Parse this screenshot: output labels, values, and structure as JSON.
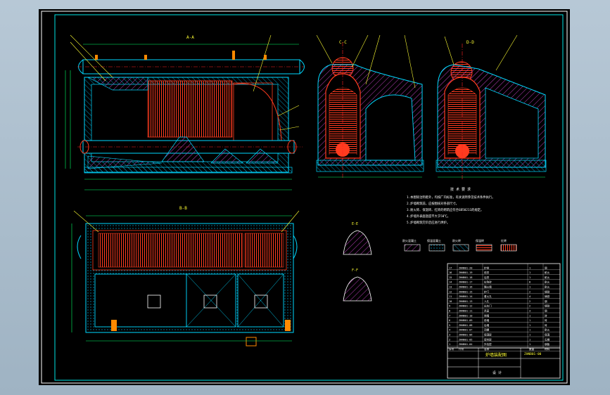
{
  "colors": {
    "background": "#000000",
    "frame": "#ffffff",
    "border_cyan": "#00e5e5",
    "tubes": "#ff3b1f",
    "hatch": "#ff40ff",
    "dims": "#00ff66",
    "leaders": "#ffff33",
    "centerlines": "#ff2020",
    "steel": "#00d8ff",
    "viewport": "#a9bccb"
  },
  "views": {
    "section_a": "A-A",
    "section_b": "B-B",
    "section_c": "C-C",
    "section_d": "D-D",
    "detail_1": "E-E",
    "detail_2": "F-F"
  },
  "notes": {
    "heading": "技 术 要 求",
    "lines": [
      "1.本图除注明者外，均按厂内标准，有关说明参见技术条件执行。",
      "2.炉墙砌筑前，应按图核对各部尺寸。",
      "3.耐火砖、保温砖、红砖的砌筑应符合GB50211的规定。",
      "4.炉墙外表面温度不大于50℃。",
      "5.炉墙砌筑完毕后应进行烘炉。"
    ]
  },
  "legend": [
    "耐火混凝土",
    "保温混凝土",
    "耐火砖",
    "保温砖",
    "红砖"
  ],
  "parts_table": {
    "rows": [
      [
        "17",
        "ZHNB01-20",
        "炉排",
        "1",
        "钢"
      ],
      [
        "16",
        "ZHNB01-19",
        "前拱",
        "1",
        "耐火"
      ],
      [
        "15",
        "ZHNB01-18",
        "后拱",
        "1",
        "耐火"
      ],
      [
        "14",
        "ZHNB01-17",
        "拉钩砖",
        "8",
        "耐火"
      ],
      [
        "13",
        "ZHNB01-16",
        "隔火墙",
        "1",
        "耐火"
      ],
      [
        "12",
        "ZHNB01-15",
        "炉门",
        "2",
        "铸铁"
      ],
      [
        "11",
        "ZHNB01-14",
        "看火孔",
        "4",
        "铸铁"
      ],
      [
        "10",
        "ZHNB01-13",
        "人孔",
        "2",
        "钢"
      ],
      [
        "9",
        "ZHNB01-12",
        "出灰门",
        "2",
        "铸铁"
      ],
      [
        "8",
        "ZHNB01-11",
        "风室",
        "3",
        "钢"
      ],
      [
        "7",
        "ZHNB01-10",
        "侧墙",
        "1",
        "砖"
      ],
      [
        "6",
        "ZHNB01-09",
        "前墙",
        "1",
        "砖"
      ],
      [
        "5",
        "ZHNB01-08",
        "后墙",
        "1",
        "砖"
      ],
      [
        "4",
        "ZHNB01-07",
        "顶棚",
        "1",
        "耐火"
      ],
      [
        "3",
        "ZHNB01-06",
        "保温层",
        "1",
        "保温"
      ],
      [
        "2",
        "ZHNB01-05",
        "密封层",
        "1",
        "石棉"
      ],
      [
        "1",
        "ZHNB01-04",
        "外包层",
        "1",
        "钢板"
      ]
    ],
    "header": [
      "序号",
      "代号",
      "名称",
      "数量",
      "材料"
    ]
  },
  "title_block": {
    "drawing_title": "炉墙装配图",
    "drawing_no": "ZHNB01-00",
    "designer_label": "设 计"
  }
}
